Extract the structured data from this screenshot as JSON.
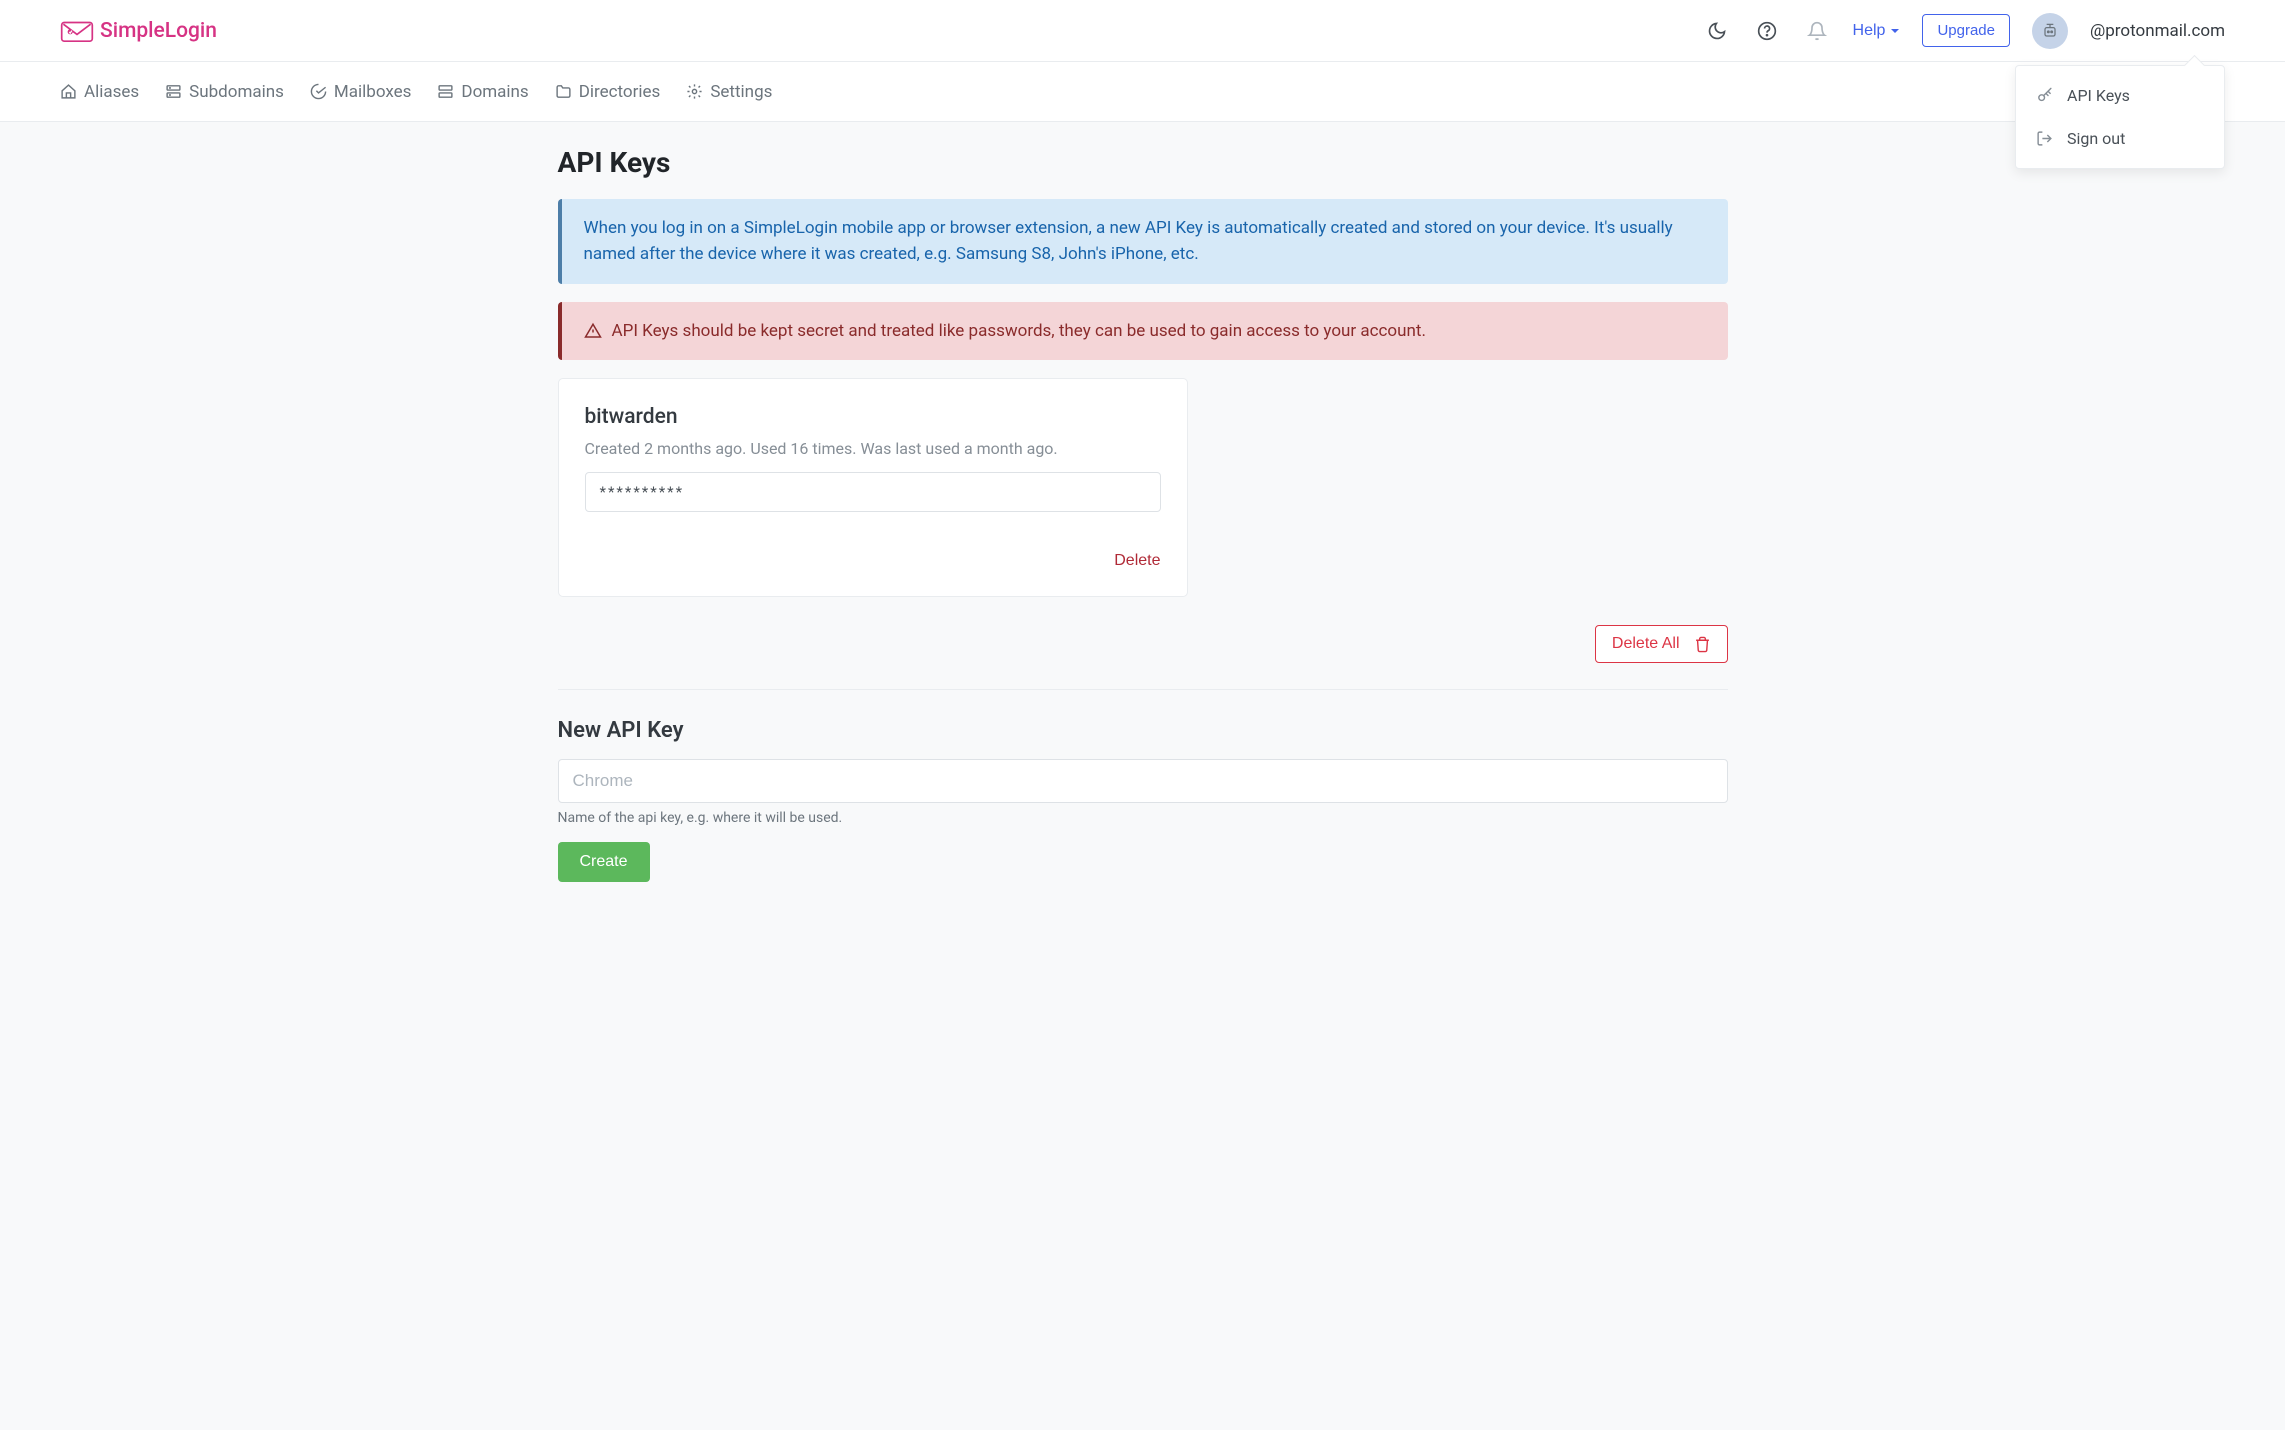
{
  "brand": {
    "name": "SimpleLogin"
  },
  "topbar": {
    "help_label": "Help",
    "upgrade_label": "Upgrade",
    "user_email": "@protonmail.com"
  },
  "dropdown": {
    "items": [
      {
        "icon": "key-icon",
        "label": "API Keys"
      },
      {
        "icon": "signout-icon",
        "label": "Sign out"
      }
    ]
  },
  "nav": {
    "items": [
      {
        "icon": "home-icon",
        "label": "Aliases"
      },
      {
        "icon": "subdomain-icon",
        "label": "Subdomains"
      },
      {
        "icon": "mailbox-icon",
        "label": "Mailboxes"
      },
      {
        "icon": "domain-icon",
        "label": "Domains"
      },
      {
        "icon": "folder-icon",
        "label": "Directories"
      },
      {
        "icon": "gear-icon",
        "label": "Settings"
      }
    ]
  },
  "page": {
    "title": "API Keys",
    "info_text": "When you log in on a SimpleLogin mobile app or browser extension, a new API Key is automatically created and stored on your device. It's usually named after the device where it was created, e.g. Samsung S8, John's iPhone, etc.",
    "warning_text": "API Keys should be kept secret and treated like passwords, they can be used to gain access to your account."
  },
  "keys": [
    {
      "name": "bitwarden",
      "meta": "Created 2 months ago. Used 16 times. Was last used a month ago.",
      "masked": "**********",
      "delete_label": "Delete"
    }
  ],
  "delete_all_label": "Delete All",
  "new_key": {
    "title": "New API Key",
    "placeholder": "Chrome",
    "help": "Name of the api key, e.g. where it will be used.",
    "create_label": "Create"
  }
}
